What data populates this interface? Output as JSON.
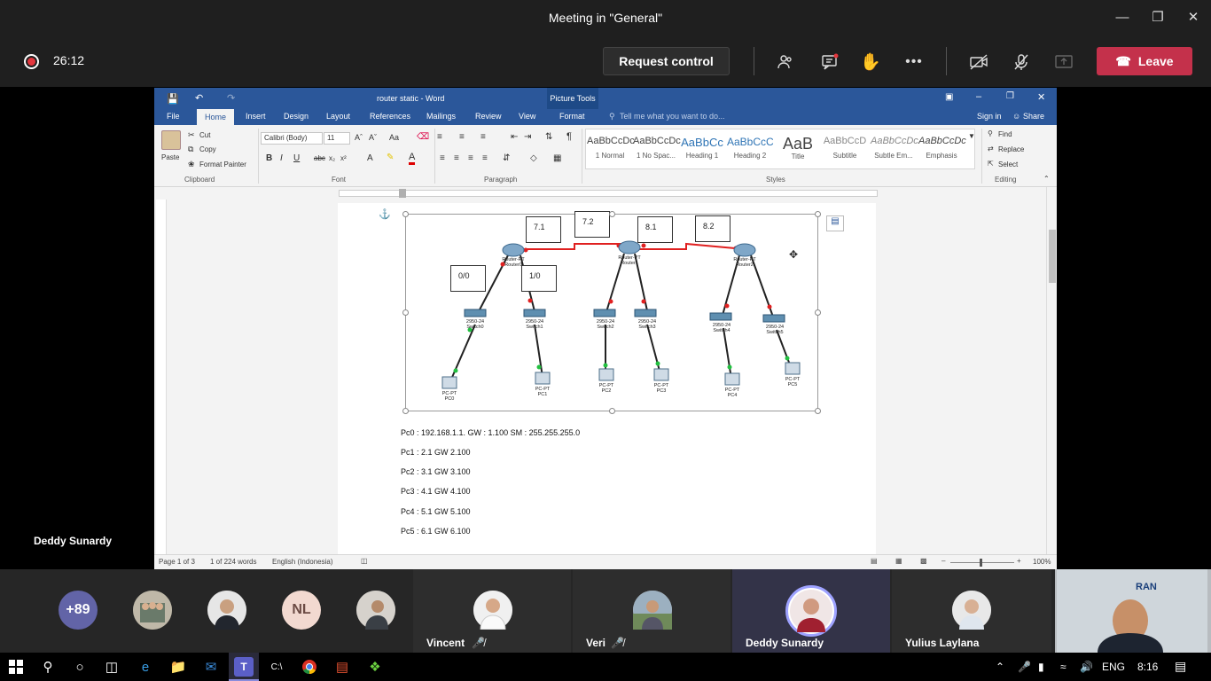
{
  "teams": {
    "window_title": "Meeting in \"General\"",
    "timer": "26:12",
    "request_control": "Request control",
    "leave": "Leave",
    "presenter": "Deddy Sunardy"
  },
  "word": {
    "title": "router static - Word",
    "picture_tools": "Picture Tools",
    "tell_me": "Tell me what you want to do...",
    "sign_in": "Sign in",
    "share": "Share",
    "tabs": [
      "File",
      "Home",
      "Insert",
      "Design",
      "Layout",
      "References",
      "Mailings",
      "Review",
      "View",
      "Format"
    ],
    "clipboard": {
      "paste": "Paste",
      "cut": "Cut",
      "copy": "Copy",
      "format_painter": "Format Painter",
      "label": "Clipboard"
    },
    "font": {
      "name": "Calibri (Body)",
      "size": "11",
      "label": "Font"
    },
    "paragraph_label": "Paragraph",
    "styles": {
      "label": "Styles",
      "items": [
        {
          "preview": "AaBbCcDc",
          "name": "1 Normal"
        },
        {
          "preview": "AaBbCcDc",
          "name": "1 No Spac..."
        },
        {
          "preview": "AaBbCc",
          "name": "Heading 1"
        },
        {
          "preview": "AaBbCcC",
          "name": "Heading 2"
        },
        {
          "preview": "AaB",
          "name": "Title"
        },
        {
          "preview": "AaBbCcD",
          "name": "Subtitle"
        },
        {
          "preview": "AaBbCcDc",
          "name": "Subtle Em..."
        },
        {
          "preview": "AaBbCcDc",
          "name": "Emphasis"
        }
      ]
    },
    "editing": {
      "find": "Find",
      "replace": "Replace",
      "select": "Select",
      "label": "Editing"
    },
    "status": {
      "page": "Page 1 of 3",
      "words": "1 of 224 words",
      "language": "English (Indonesia)",
      "zoom": "100%"
    },
    "diagram_labels": {
      "l71": "7.1",
      "l72": "7.2",
      "l81": "8.1",
      "l82": "8.2",
      "l00": "0/0",
      "l10": "1/0",
      "router0": "Router-PT\nRouter0",
      "router1": "Router-PT\nRouter1",
      "router2": "Router-PT\nRouter2",
      "sw0": "2950-24\nSwitch0",
      "sw1": "2950-24\nSwitch1",
      "sw2": "2950-24\nSwitch2",
      "sw3": "2950-24\nSwitch3",
      "sw4": "2950-24\nSwitch4",
      "sw5": "2950-24\nSwitch5",
      "pc0": "PC-PT\nPC0",
      "pc1": "PC-PT\nPC1",
      "pc2": "PC-PT\nPC2",
      "pc3": "PC-PT\nPC3",
      "pc4": "PC-PT\nPC4",
      "pc5": "PC-PT\nPC5"
    },
    "ip_lines": [
      "Pc0 : 192.168.1.1. GW : 1.100 SM : 255.255.255.0",
      "Pc1 : 2.1 GW 2.100",
      "Pc2 : 3.1 GW 3.100",
      "Pc3 : 4.1 GW 4.100",
      "Pc4 : 5.1 GW 5.100",
      "Pc5 : 6.1 GW 6.100"
    ]
  },
  "participants": {
    "overflow": "+89",
    "initials": "NL",
    "tiles": [
      {
        "name": "Vincent"
      },
      {
        "name": "Veri"
      },
      {
        "name": "Deddy Sunardy"
      },
      {
        "name": "Yulius Laylana"
      }
    ],
    "self_caption": "RAN"
  },
  "taskbar": {
    "lang": "ENG",
    "time": "8:16"
  },
  "colors": {
    "leave": "#c4314b",
    "word_blue": "#2b579a",
    "record": "#e3363d",
    "link_red": "#e02020"
  }
}
